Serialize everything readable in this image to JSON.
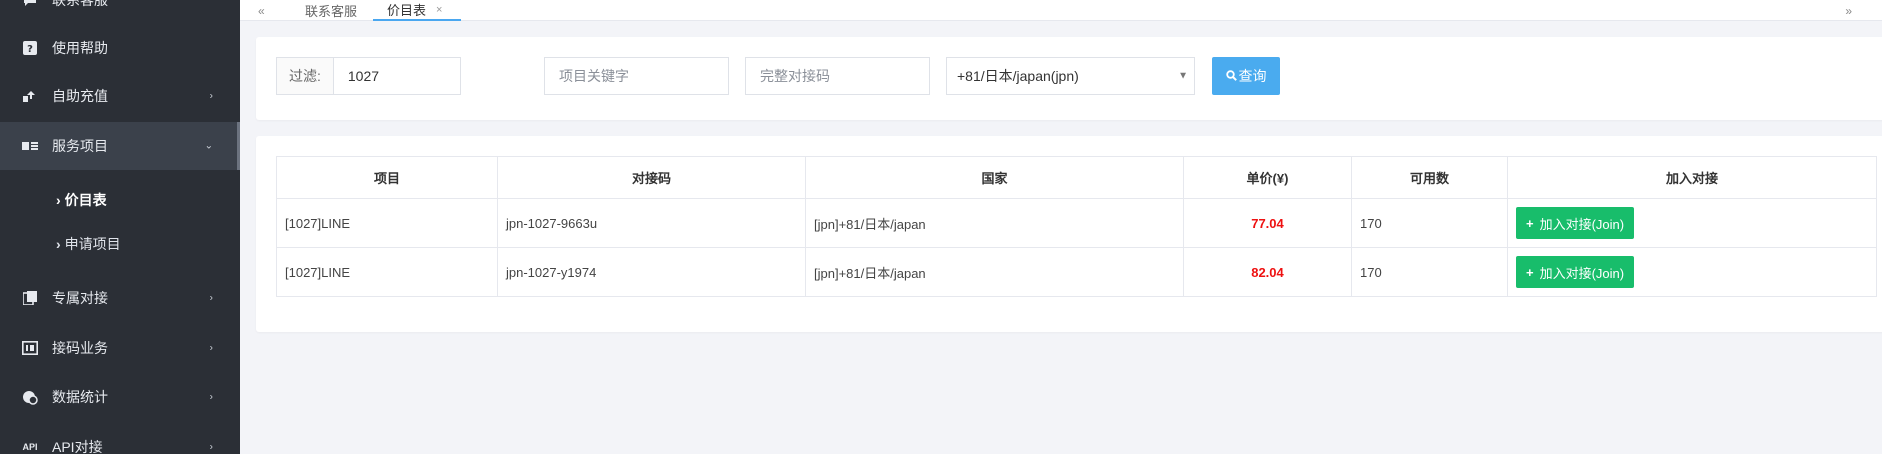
{
  "sidebar": {
    "items": [
      {
        "label": "联系客服",
        "icon": "chat-icon"
      },
      {
        "label": "使用帮助",
        "icon": "help-icon"
      },
      {
        "label": "自助充值",
        "icon": "recharge-icon"
      },
      {
        "label": "服务项目",
        "icon": "services-icon"
      },
      {
        "label": "专属对接",
        "icon": "dedicated-icon"
      },
      {
        "label": "接码业务",
        "icon": "sms-code-icon"
      },
      {
        "label": "数据统计",
        "icon": "stats-icon"
      },
      {
        "label": "API对接",
        "icon": "api-icon"
      }
    ],
    "sub_items": [
      {
        "label": "价目表"
      },
      {
        "label": "申请项目"
      }
    ],
    "api_icon_text": "API"
  },
  "tabs": {
    "nav_left": "«",
    "items": [
      {
        "label": "联系客服"
      },
      {
        "label": "价目表"
      }
    ],
    "tab_close": "×",
    "nav_right": "»"
  },
  "filter": {
    "prefix_label": "过滤:",
    "value": "1027",
    "keyword_placeholder": "项目关键字",
    "code_placeholder": "完整对接码",
    "country_selected": "+81/日本/japan(jpn)",
    "query_label": "查询"
  },
  "table": {
    "headers": [
      "项目",
      "对接码",
      "国家",
      "单价(¥)",
      "可用数",
      "加入对接"
    ],
    "rows": [
      {
        "project": "[1027]LINE",
        "code": "jpn-1027-9663u",
        "country": "[jpn]+81/日本/japan",
        "price": "77.04",
        "available": "170",
        "action": "加入对接(Join)"
      },
      {
        "project": "[1027]LINE",
        "code": "jpn-1027-y1974",
        "country": "[jpn]+81/日本/japan",
        "price": "82.04",
        "available": "170",
        "action": "加入对接(Join)"
      }
    ]
  },
  "colors": {
    "sidebar_bg": "#2b2f36",
    "query_button": "#4aabef",
    "join_button": "#18bd6b",
    "price_text": "#ee1111"
  }
}
